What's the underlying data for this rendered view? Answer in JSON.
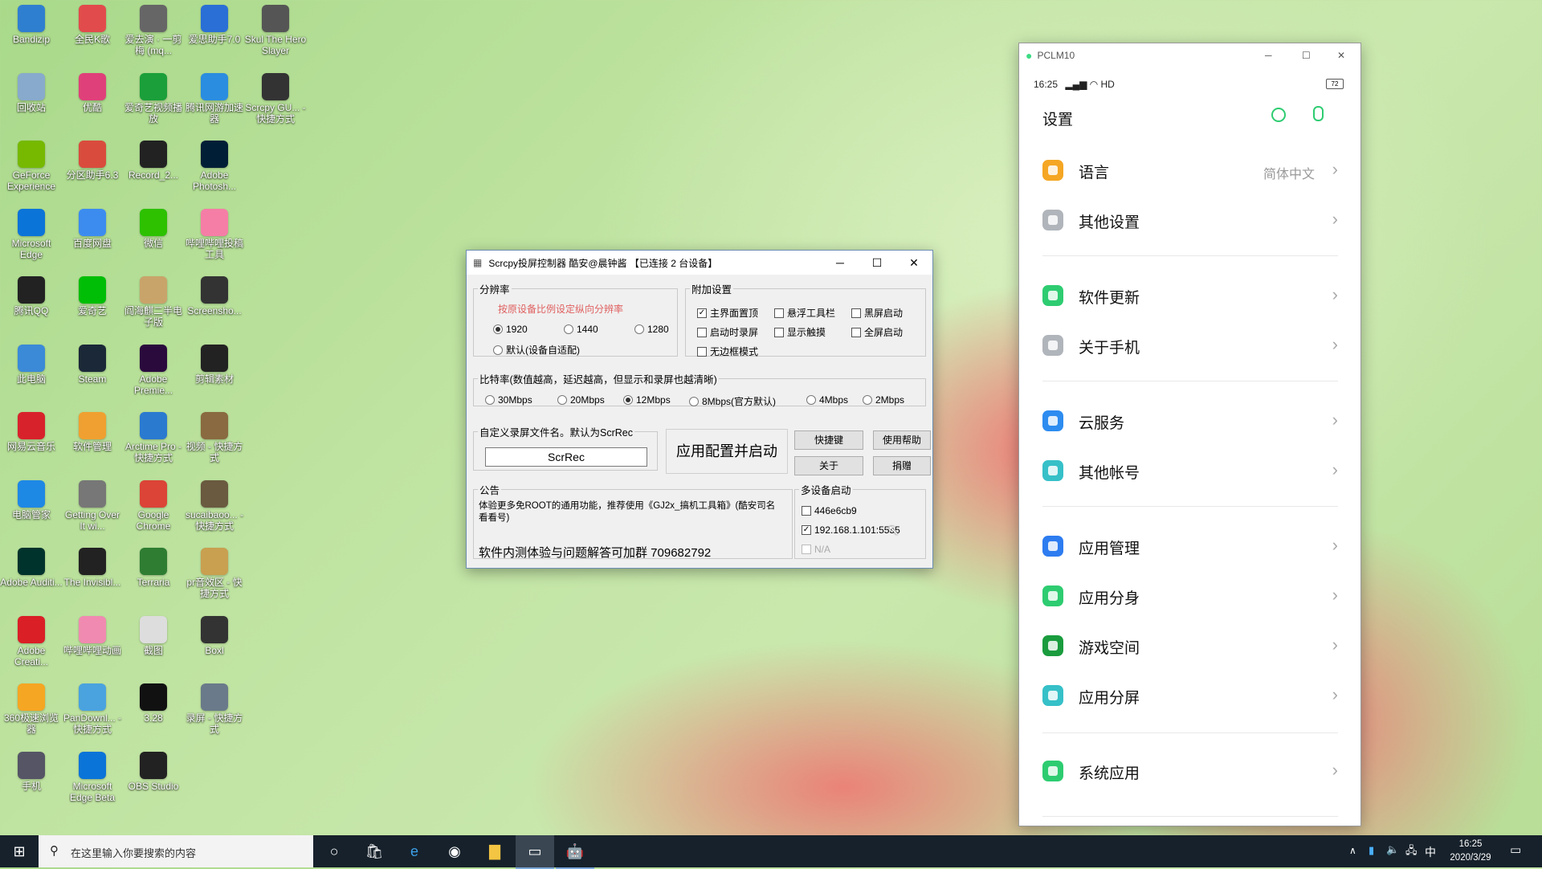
{
  "desktop": {
    "icons": [
      {
        "label": "Bandizip",
        "icon": "bandizip-icon",
        "color": "#2f7fd0"
      },
      {
        "label": "全民K歌",
        "icon": "karaoke-icon",
        "color": "#e24b4b"
      },
      {
        "label": "爱去演 · 一剪梅 (mq...",
        "icon": "audio-file-icon",
        "color": "#666"
      },
      {
        "label": "爱思助手7.0",
        "icon": "aisi-icon",
        "color": "#2a6fd6"
      },
      {
        "label": "Skul The Hero Slayer",
        "icon": "game-icon",
        "color": "#555"
      },
      {
        "label": "回收站",
        "icon": "recycle-bin-icon",
        "color": "#88aacc"
      },
      {
        "label": "优酷",
        "icon": "youku-icon",
        "color": "#e0407a"
      },
      {
        "label": "爱奇艺视频播放",
        "icon": "iqiyi-player-icon",
        "color": "#1a9f3a"
      },
      {
        "label": "腾讯网游加速器",
        "icon": "tencent-accelerator-icon",
        "color": "#2a8de0"
      },
      {
        "label": "Scrcpy GU... - 快捷方式",
        "icon": "scrcpy-icon",
        "color": "#333"
      },
      {
        "label": "GeForce Experience",
        "icon": "geforce-icon",
        "color": "#76b900"
      },
      {
        "label": "分区助手6.3",
        "icon": "partition-icon",
        "color": "#d94c3d"
      },
      {
        "label": "Record_2...",
        "icon": "video-file-icon",
        "color": "#222"
      },
      {
        "label": "Adobe Photosh...",
        "icon": "photoshop-icon",
        "color": "#001e36"
      },
      {
        "label": "Microsoft Edge",
        "icon": "edge-icon",
        "color": "#0a74d8"
      },
      {
        "label": "百度网盘",
        "icon": "baidu-netdisk-icon",
        "color": "#3c8cf0"
      },
      {
        "label": "微信",
        "icon": "wechat-icon",
        "color": "#2dc100"
      },
      {
        "label": "哔哩哔哩投稿工具",
        "icon": "bilibili-upload-icon",
        "color": "#f57ea6"
      },
      {
        "label": "腾讯QQ",
        "icon": "qq-icon",
        "color": "#222"
      },
      {
        "label": "爱奇艺",
        "icon": "iqiyi-icon",
        "color": "#00be06"
      },
      {
        "label": "阎海麒二半电子版",
        "icon": "document-icon",
        "color": "#c9a46a"
      },
      {
        "label": "Screensho...",
        "icon": "image-file-icon",
        "color": "#333"
      },
      {
        "label": "此电脑",
        "icon": "this-pc-icon",
        "color": "#3b8ad8"
      },
      {
        "label": "Steam",
        "icon": "steam-icon",
        "color": "#1b2838"
      },
      {
        "label": "Adobe Premie...",
        "icon": "premiere-icon",
        "color": "#2a0a3d"
      },
      {
        "label": "剪辑素材",
        "icon": "folder-icon",
        "color": "#222"
      },
      {
        "label": "网易云音乐",
        "icon": "netease-music-icon",
        "color": "#d8222b"
      },
      {
        "label": "软件管理",
        "icon": "software-manager-icon",
        "color": "#f0a030"
      },
      {
        "label": "Arctime Pro - 快捷方式",
        "icon": "arctime-icon",
        "color": "#2a7ad0"
      },
      {
        "label": "视频 - 快捷方式",
        "icon": "video-shortcut-icon",
        "color": "#8a6a40"
      },
      {
        "label": "电脑管家",
        "icon": "pc-manager-icon",
        "color": "#1e88e5"
      },
      {
        "label": "Getting Over It wi...",
        "icon": "getting-over-it-icon",
        "color": "#777"
      },
      {
        "label": "Google Chrome",
        "icon": "chrome-icon",
        "color": "#db4437"
      },
      {
        "label": "sucaibaoo... - 快捷方式",
        "icon": "shortcut-icon",
        "color": "#6a5a40"
      },
      {
        "label": "Adobe Auditi...",
        "icon": "audition-icon",
        "color": "#00332b"
      },
      {
        "label": "The Invisibl...",
        "icon": "invisible-game-icon",
        "color": "#222"
      },
      {
        "label": "Terraria",
        "icon": "terraria-icon",
        "color": "#2e7d32"
      },
      {
        "label": "pr音效区 - 快捷方式",
        "icon": "folder-shortcut-icon",
        "color": "#c8a050"
      },
      {
        "label": "Adobe Creati...",
        "icon": "creative-cloud-icon",
        "color": "#da1f26"
      },
      {
        "label": "哔哩哔哩动画",
        "icon": "bilibili-icon",
        "color": "#f08ab0"
      },
      {
        "label": "截图",
        "icon": "screenshot-file-icon",
        "color": "#ddd"
      },
      {
        "label": "Boxl",
        "icon": "boxl-icon",
        "color": "#333"
      },
      {
        "label": "360极速浏览器",
        "icon": "browser-360-icon",
        "color": "#f5a623"
      },
      {
        "label": "PanDownl... - 快捷方式",
        "icon": "pandownload-icon",
        "color": "#4aa3df"
      },
      {
        "label": "3.28",
        "icon": "video-file-icon",
        "color": "#111"
      },
      {
        "label": "录屏 - 快捷方式",
        "icon": "recording-shortcut-icon",
        "color": "#6a7a8a"
      },
      {
        "label": "手机",
        "icon": "phone-folder-icon",
        "color": "#556"
      },
      {
        "label": "Microsoft Edge Beta",
        "icon": "edge-beta-icon",
        "color": "#0a74d8"
      },
      {
        "label": "OBS Studio",
        "icon": "obs-icon",
        "color": "#222"
      }
    ]
  },
  "scrcpy": {
    "title": "Scrcpy投屏控制器 酷安@晨钟酱 【已连接 2 台设备】",
    "resolution": {
      "legend": "分辨率",
      "hint": "按原设备比例设定纵向分辨率",
      "options": [
        "1920",
        "1440",
        "1280",
        "默认(设备自适配)"
      ],
      "selected": "1920"
    },
    "extra": {
      "legend": "附加设置",
      "options": [
        {
          "label": "主界面置顶",
          "checked": true
        },
        {
          "label": "悬浮工具栏",
          "checked": false
        },
        {
          "label": "黑屏启动",
          "checked": false
        },
        {
          "label": "启动时录屏",
          "checked": false
        },
        {
          "label": "显示触摸",
          "checked": false
        },
        {
          "label": "全屏启动",
          "checked": false
        },
        {
          "label": "无边框模式",
          "checked": false
        }
      ]
    },
    "bitrate": {
      "legend": "比特率(数值越高，延迟越高，但显示和录屏也越清晰)",
      "options": [
        "30Mbps",
        "20Mbps",
        "12Mbps",
        "8Mbps(官方默认)",
        "4Mbps",
        "2Mbps"
      ],
      "selected": "12Mbps"
    },
    "filename": {
      "legend": "自定义录屏文件名。默认为ScrRec",
      "value": "ScrRec"
    },
    "apply_button": "应用配置并启动",
    "buttons": {
      "shortcuts": "快捷键",
      "help": "使用帮助",
      "about": "关于",
      "donate": "捐赠"
    },
    "notice": {
      "legend": "公告",
      "text": "体验更多免ROOT的通用功能，推荐使用《GJ2x_搞机工具箱》(酷安司名看看号)",
      "group": "软件内测体验与问题解答可加群 709682792"
    },
    "multi": {
      "legend": "多设备启动",
      "devices": [
        {
          "label": "446e6cb9",
          "checked": false
        },
        {
          "label": "192.168.1.101:5555",
          "checked": true
        },
        {
          "label": "N/A",
          "checked": false,
          "disabled": true
        }
      ]
    }
  },
  "phone": {
    "window_title": "PCLM10",
    "status": {
      "time": "16:25",
      "network": "HD",
      "battery": "72"
    },
    "header_title": "设置",
    "items": [
      {
        "label": "语言",
        "value": "简体中文",
        "color": "#f5a623"
      },
      {
        "label": "其他设置",
        "value": "",
        "color": "#b0b5bb"
      },
      {
        "label": "软件更新",
        "value": "",
        "color": "#2ecc71"
      },
      {
        "label": "关于手机",
        "value": "",
        "color": "#b0b5bb"
      },
      {
        "label": "云服务",
        "value": "",
        "color": "#2d8cf0"
      },
      {
        "label": "其他帐号",
        "value": "",
        "color": "#36c0c8"
      },
      {
        "label": "应用管理",
        "value": "",
        "color": "#2d7cf0"
      },
      {
        "label": "应用分身",
        "value": "",
        "color": "#2ecc71"
      },
      {
        "label": "游戏空间",
        "value": "",
        "color": "#1a9c3e"
      },
      {
        "label": "应用分屏",
        "value": "",
        "color": "#36c0c8"
      },
      {
        "label": "系统应用",
        "value": "",
        "color": "#2ecc71"
      }
    ]
  },
  "taskbar": {
    "search_placeholder": "在这里输入你要搜索的内容",
    "time": "16:25",
    "date": "2020/3/29",
    "ime": "中"
  }
}
